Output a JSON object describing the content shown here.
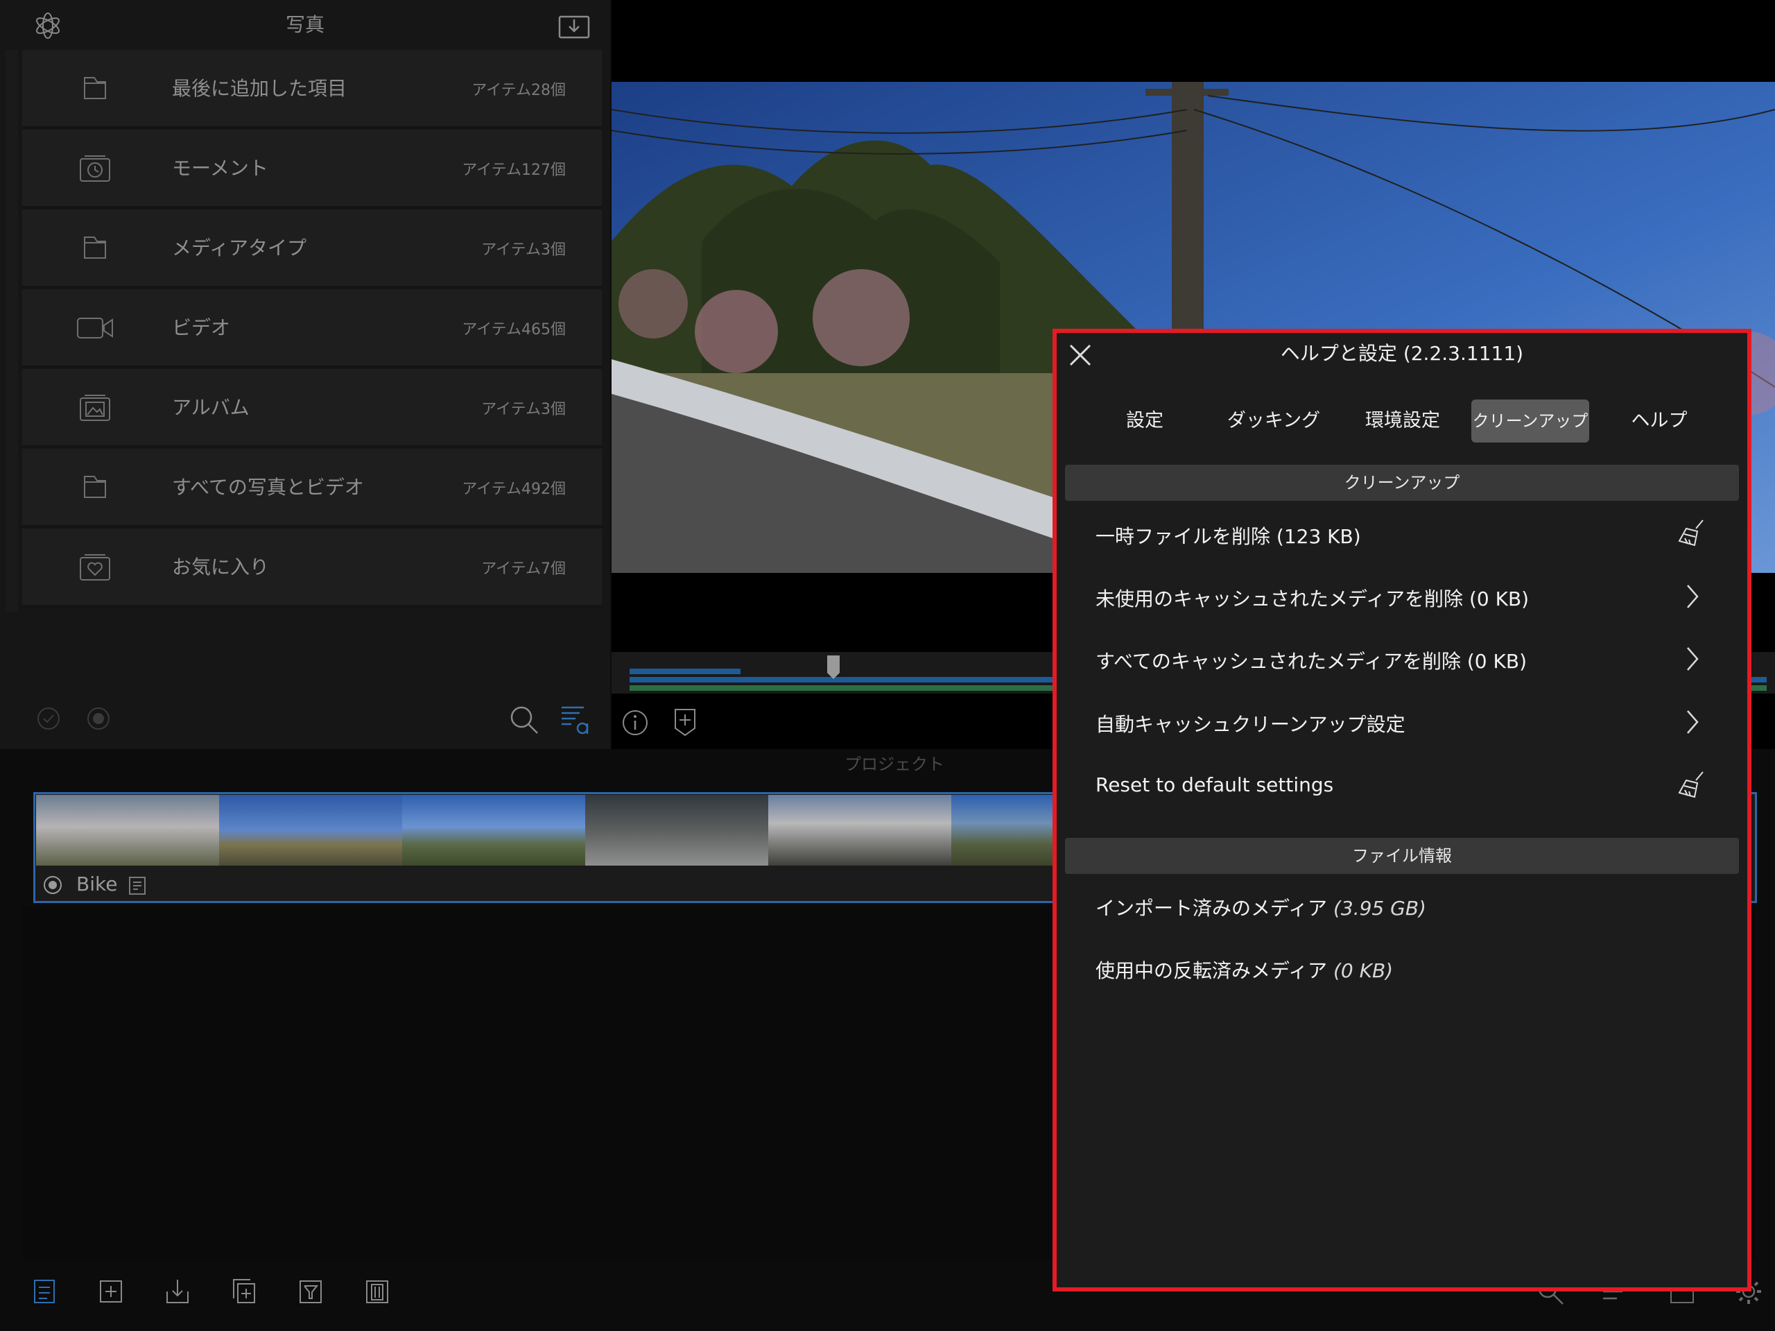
{
  "library": {
    "title": "写真",
    "items": [
      {
        "label": "最後に追加した項目",
        "count": "アイテム28個",
        "icon": "folder-icon"
      },
      {
        "label": "モーメント",
        "count": "アイテム127個",
        "icon": "moments-icon"
      },
      {
        "label": "メディアタイプ",
        "count": "アイテム3個",
        "icon": "folder-icon"
      },
      {
        "label": "ビデオ",
        "count": "アイテム465個",
        "icon": "video-camera-icon"
      },
      {
        "label": "アルバム",
        "count": "アイテム3個",
        "icon": "album-icon"
      },
      {
        "label": "すべての写真とビデオ",
        "count": "アイテム492個",
        "icon": "folder-icon"
      },
      {
        "label": "お気に入り",
        "count": "アイテム7個",
        "icon": "favorites-icon"
      }
    ]
  },
  "project": {
    "section_title": "プロジェクト",
    "name": "Bike"
  },
  "settings": {
    "title": "ヘルプと設定 (2.2.3.1111)",
    "tabs": [
      "設定",
      "ダッキング",
      "環境設定",
      "クリーンアップ",
      "ヘルプ"
    ],
    "selected_tab": "クリーンアップ",
    "cleanup": {
      "header": "クリーンアップ",
      "rows": [
        {
          "label": "一時ファイルを削除 (123 KB)",
          "accessory": "broom-icon"
        },
        {
          "label": "未使用のキャッシュされたメディアを削除 (0 KB)",
          "accessory": "chevron-right-icon"
        },
        {
          "label": "すべてのキャッシュされたメディアを削除 (0 KB)",
          "accessory": "chevron-right-icon"
        },
        {
          "label": "自動キャッシュクリーンアップ設定",
          "accessory": "chevron-right-icon"
        },
        {
          "label": "Reset to default settings",
          "accessory": "broom-icon"
        }
      ]
    },
    "file_info": {
      "header": "ファイル情報",
      "rows": [
        {
          "label": "インポート済みのメディア",
          "value": "(3.95 GB)"
        },
        {
          "label": "使用中の反転済みメディア",
          "value": "(0 KB)"
        }
      ]
    }
  },
  "colors": {
    "highlight_border": "#e51b24",
    "accent_blue": "#2f6fb0",
    "panel_bg": "#1c1c1c"
  }
}
